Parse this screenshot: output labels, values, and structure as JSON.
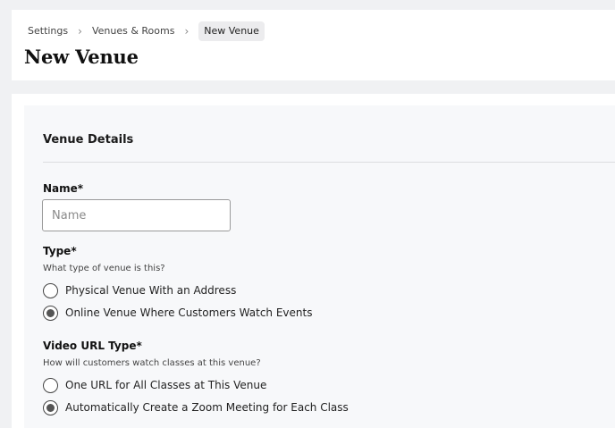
{
  "breadcrumb": {
    "items": [
      "Settings",
      "Venues & Rooms"
    ],
    "current": "New Venue"
  },
  "page": {
    "title": "New Venue"
  },
  "section": {
    "title": "Venue Details"
  },
  "name_field": {
    "label": "Name*",
    "placeholder": "Name",
    "value": ""
  },
  "type_field": {
    "label": "Type*",
    "help": "What type of venue is this?",
    "options": [
      {
        "label": "Physical Venue With an Address",
        "selected": false
      },
      {
        "label": "Online Venue Where Customers Watch Events",
        "selected": true
      }
    ]
  },
  "video_url_field": {
    "label": "Video URL Type*",
    "help": "How will customers watch classes at this venue?",
    "options": [
      {
        "label": "One URL for All Classes at This Venue",
        "selected": false
      },
      {
        "label": "Automatically Create a Zoom Meeting for Each Class",
        "selected": true
      }
    ]
  }
}
